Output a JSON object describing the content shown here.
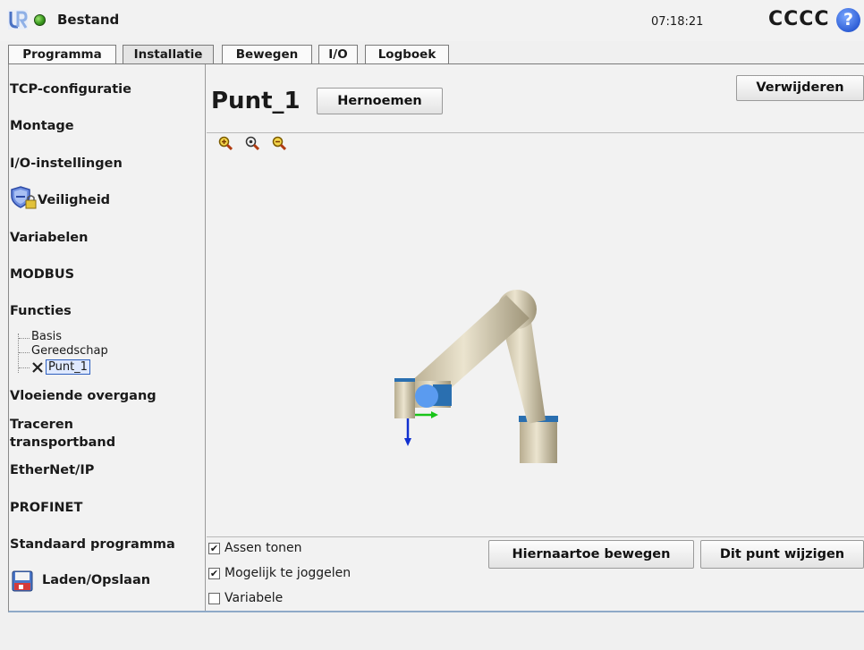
{
  "header": {
    "app_title": "Bestand",
    "time": "07:18:21",
    "robot_name": "CCCC",
    "help_glyph": "?"
  },
  "tabs": [
    {
      "label": "Programma"
    },
    {
      "label": "Installatie",
      "active": true
    },
    {
      "label": "Bewegen"
    },
    {
      "label": "I/O"
    },
    {
      "label": "Logboek"
    }
  ],
  "sidebar": {
    "items": [
      {
        "label": "TCP-configuratie"
      },
      {
        "label": "Montage"
      },
      {
        "label": "I/O-instellingen"
      },
      {
        "label": "Veiligheid",
        "icon": "shield-lock-icon"
      },
      {
        "label": "Variabelen"
      },
      {
        "label": "MODBUS"
      },
      {
        "label": "Functies"
      },
      {
        "label": "Vloeiende overgang"
      },
      {
        "label": "Traceren\ntransportband"
      },
      {
        "label": "EtherNet/IP"
      },
      {
        "label": "PROFINET"
      },
      {
        "label": "Standaard programma"
      },
      {
        "label": "Laden/Opslaan",
        "icon": "floppy-disk-icon"
      }
    ],
    "tree": [
      {
        "label": "Basis"
      },
      {
        "label": "Gereedschap"
      },
      {
        "label": "Punt_1",
        "selected": true,
        "icon": "point-x-icon"
      }
    ]
  },
  "main": {
    "title": "Punt_1",
    "rename_label": "Hernoemen",
    "delete_label": "Verwijderen",
    "move_here_label": "Hiernaartoe bewegen",
    "change_point_label": "Dit punt wijzigen",
    "options": [
      {
        "label": "Assen tonen",
        "checked": true
      },
      {
        "label": "Mogelijk te joggelen",
        "checked": true
      },
      {
        "label": "Variabele",
        "checked": false
      }
    ],
    "checked_glyph": "✔"
  },
  "colors": {
    "accent": "#2f5fd6",
    "robot_body": "#d8cfb4",
    "robot_ring": "#2a6fb0",
    "axis_x": "#19c419",
    "axis_z": "#1030d0"
  }
}
